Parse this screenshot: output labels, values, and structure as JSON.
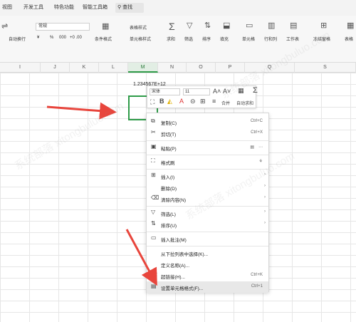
{
  "menu_tabs": [
    "视图",
    "开发工具",
    "特色功能",
    "智能工具箱"
  ],
  "search": {
    "label": "查找"
  },
  "ribbon": {
    "wrap_label": "自动换行",
    "format_value": "常规",
    "currency_symbol": "¥",
    "percent": "%",
    "thousands": "000",
    "dec_increase": "+0 .00",
    "dec_decrease": "-0 .00",
    "conditional_format": "条件格式",
    "table_style": "表格样式",
    "cell_style": "单元格样式",
    "sum": "求和",
    "filter": "筛选",
    "sort": "排序",
    "fill": "填充",
    "cell": "单元格",
    "rowcol": "行和列",
    "worksheet": "工作表",
    "freeze": "冻结窗格",
    "table_tools": "表格"
  },
  "columns": [
    "I",
    "J",
    "K",
    "L",
    "M",
    "N",
    "O",
    "P",
    "Q",
    "S"
  ],
  "cell_value": "1.234567",
  "cell_value_overflow": "E+12",
  "mini_toolbar": {
    "font": "宋体",
    "size": "11",
    "bold": "B",
    "merge": "合并",
    "autosum": "自动求和"
  },
  "context_menu": [
    {
      "label": "复制(C)",
      "shortcut": "Ctrl+C",
      "icon": "copy-icon",
      "glyph": "⧉"
    },
    {
      "label": "剪切(T)",
      "shortcut": "Ctrl+X",
      "icon": "cut-icon",
      "glyph": "✂"
    },
    {
      "label": "粘贴(P)",
      "shortcut": "",
      "icon": "paste-icon",
      "glyph": "📋"
    },
    {
      "label": "格式刷",
      "shortcut": "",
      "icon": "format-painter-icon",
      "glyph": "🖌"
    },
    {
      "label": "插入(I)",
      "shortcut": "",
      "icon": "insert-icon",
      "glyph": "⊞"
    },
    {
      "label": "删除(D)",
      "shortcut": "",
      "icon": "delete-icon",
      "glyph": ""
    },
    {
      "label": "清除内容(N)",
      "shortcut": "",
      "icon": "clear-icon",
      "glyph": "⌫"
    },
    {
      "label": "筛选(L)",
      "shortcut": "",
      "icon": "filter-icon",
      "glyph": "▽"
    },
    {
      "label": "排序(U)",
      "shortcut": "",
      "icon": "sort-icon",
      "glyph": "⇅"
    },
    {
      "label": "插入批注(M)",
      "shortcut": "",
      "icon": "comment-icon",
      "glyph": "▭"
    },
    {
      "label": "从下拉列表中选择(K)...",
      "shortcut": "",
      "icon": "",
      "glyph": ""
    },
    {
      "label": "定义名称(A)...",
      "shortcut": "",
      "icon": "",
      "glyph": ""
    },
    {
      "label": "超链接(H)...",
      "shortcut": "Ctrl+K",
      "icon": "link-icon",
      "glyph": "🔗"
    },
    {
      "label": "设置单元格格式(F)...",
      "shortcut": "Ctrl+1",
      "icon": "format-cells-icon",
      "glyph": "▤"
    }
  ],
  "watermark": "系统部落 xitongbuluo.com",
  "colors": {
    "accent": "#2e9b48",
    "arrow": "#e8453c"
  }
}
